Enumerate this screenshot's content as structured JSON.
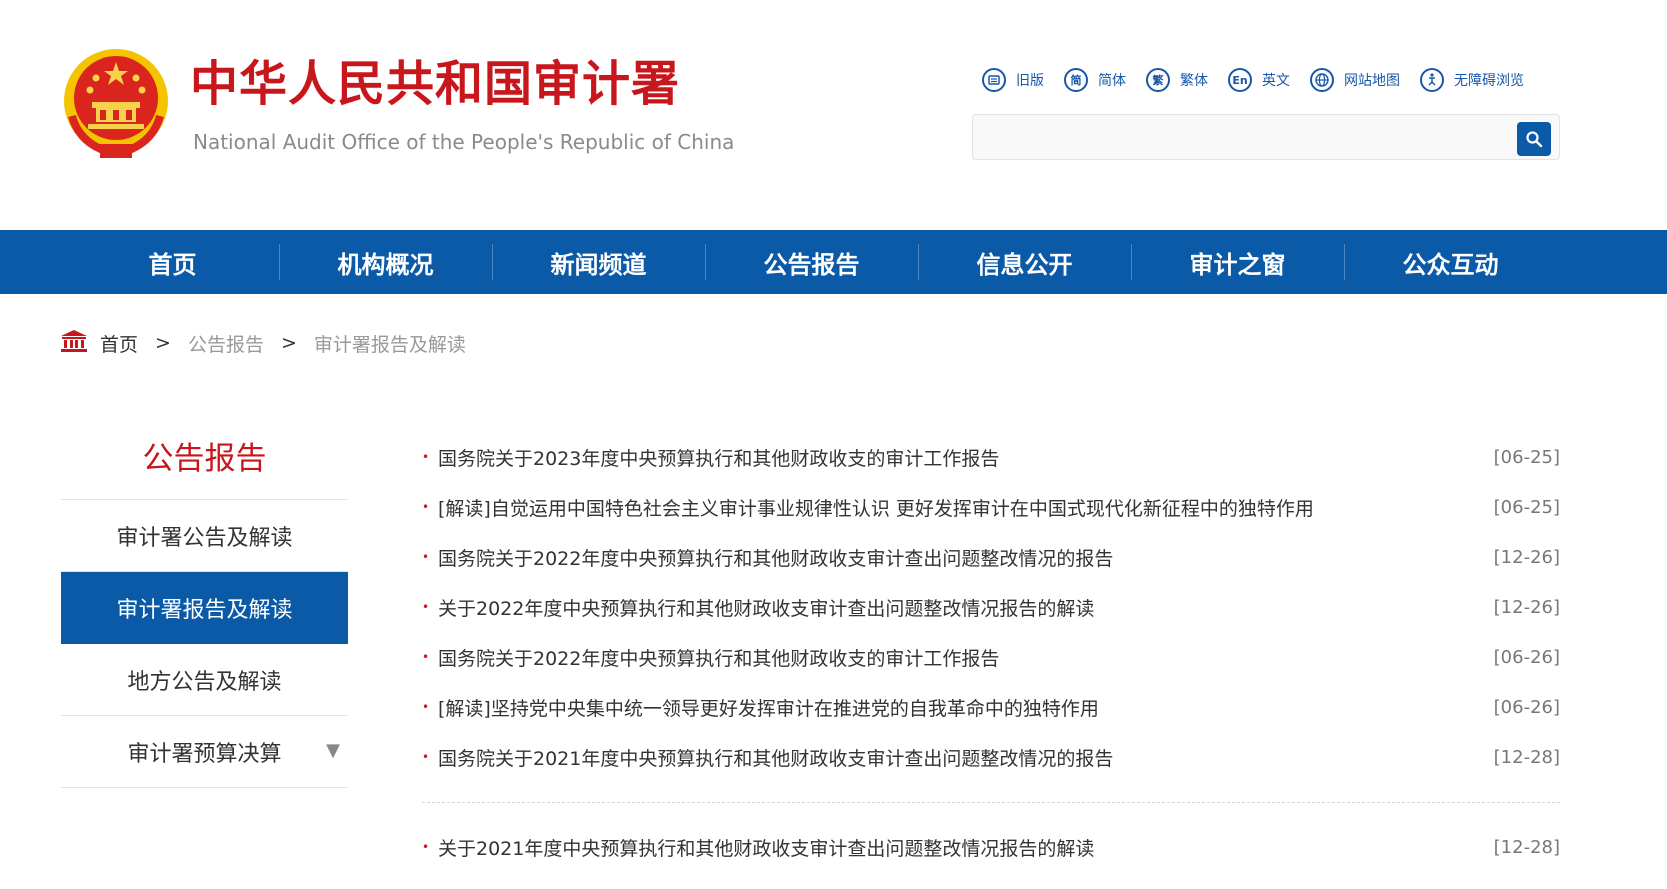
{
  "header": {
    "title": "中华人民共和国审计署",
    "subtitle": "National Audit Office of the People's Republic of China",
    "brand_color": "#c8161d"
  },
  "toolbar": [
    {
      "label": "旧版",
      "icon": "old-version-icon",
      "glyph": ""
    },
    {
      "label": "简体",
      "icon": "simplified-icon",
      "glyph": "简"
    },
    {
      "label": "繁体",
      "icon": "traditional-icon",
      "glyph": "繁"
    },
    {
      "label": "英文",
      "icon": "english-icon",
      "glyph": "En"
    },
    {
      "label": "网站地图",
      "icon": "sitemap-icon",
      "glyph": ""
    },
    {
      "label": "无障碍浏览",
      "icon": "accessibility-icon",
      "glyph": ""
    }
  ],
  "search": {
    "placeholder": "",
    "value": "",
    "icon": "search-icon"
  },
  "nav": {
    "color": "#0b5aa8",
    "items": [
      "首页",
      "机构概况",
      "新闻频道",
      "公告报告",
      "信息公开",
      "审计之窗",
      "公众互动"
    ]
  },
  "breadcrumb": {
    "home_label": "首页",
    "separator": ">",
    "items": [
      "公告报告",
      "审计署报告及解读"
    ]
  },
  "sidebar": {
    "title": "公告报告",
    "items": [
      {
        "label": "审计署公告及解读",
        "active": false
      },
      {
        "label": "审计署报告及解读",
        "active": true
      },
      {
        "label": "地方公告及解读",
        "active": false
      },
      {
        "label": "审计署预算决算",
        "active": false,
        "has_caret": true
      }
    ],
    "caret": "▼"
  },
  "list": {
    "bullet": "•",
    "items": [
      {
        "title": "国务院关于2023年度中央预算执行和其他财政收支的审计工作报告",
        "date": "[06-25]"
      },
      {
        "title": "[解读]自觉运用中国特色社会主义审计事业规律性认识 更好发挥审计在中国式现代化新征程中的独特作用",
        "date": "[06-25]"
      },
      {
        "title": "国务院关于2022年度中央预算执行和其他财政收支审计查出问题整改情况的报告",
        "date": "[12-26]"
      },
      {
        "title": "关于2022年度中央预算执行和其他财政收支审计查出问题整改情况报告的解读",
        "date": "[12-26]"
      },
      {
        "title": "国务院关于2022年度中央预算执行和其他财政收支的审计工作报告",
        "date": "[06-26]"
      },
      {
        "title": "[解读]坚持党中央集中统一领导更好发挥审计在推进党的自我革命中的独特作用",
        "date": "[06-26]"
      },
      {
        "title": "国务院关于2021年度中央预算执行和其他财政收支审计查出问题整改情况的报告",
        "date": "[12-28]"
      }
    ],
    "items_after_divider": [
      {
        "title": "关于2021年度中央预算执行和其他财政收支审计查出问题整改情况报告的解读",
        "date": "[12-28]"
      }
    ]
  }
}
